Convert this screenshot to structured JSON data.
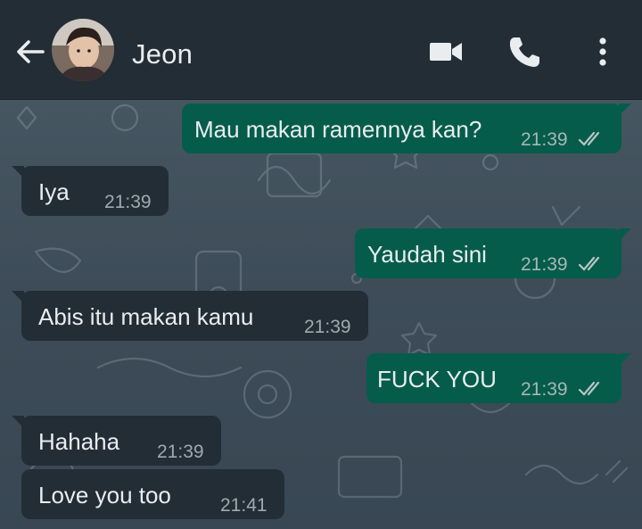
{
  "header": {
    "contact_name": "Jeon",
    "icons": [
      "back-arrow-icon",
      "avatar",
      "video-call-icon",
      "phone-icon",
      "more-vert-icon"
    ]
  },
  "colors": {
    "header_bg": "#232d36",
    "outgoing_bubble": "#055c4b",
    "incoming_bubble": "#232d36",
    "text": "#e9edef",
    "wallpaper": "#3a4a55"
  },
  "messages": [
    {
      "direction": "out",
      "text": "Mau makan ramennya kan?",
      "time": "21:39",
      "status": "read"
    },
    {
      "direction": "in",
      "text": "Iya",
      "time": "21:39"
    },
    {
      "direction": "out",
      "text": "Yaudah sini",
      "time": "21:39",
      "status": "read"
    },
    {
      "direction": "in",
      "text": "Abis itu makan kamu",
      "time": "21:39"
    },
    {
      "direction": "out",
      "text": "FUCK YOU",
      "time": "21:39",
      "status": "read"
    },
    {
      "direction": "in",
      "text": "Hahaha",
      "time": "21:39"
    },
    {
      "direction": "in",
      "text": "Love you too",
      "time": "21:41"
    }
  ]
}
